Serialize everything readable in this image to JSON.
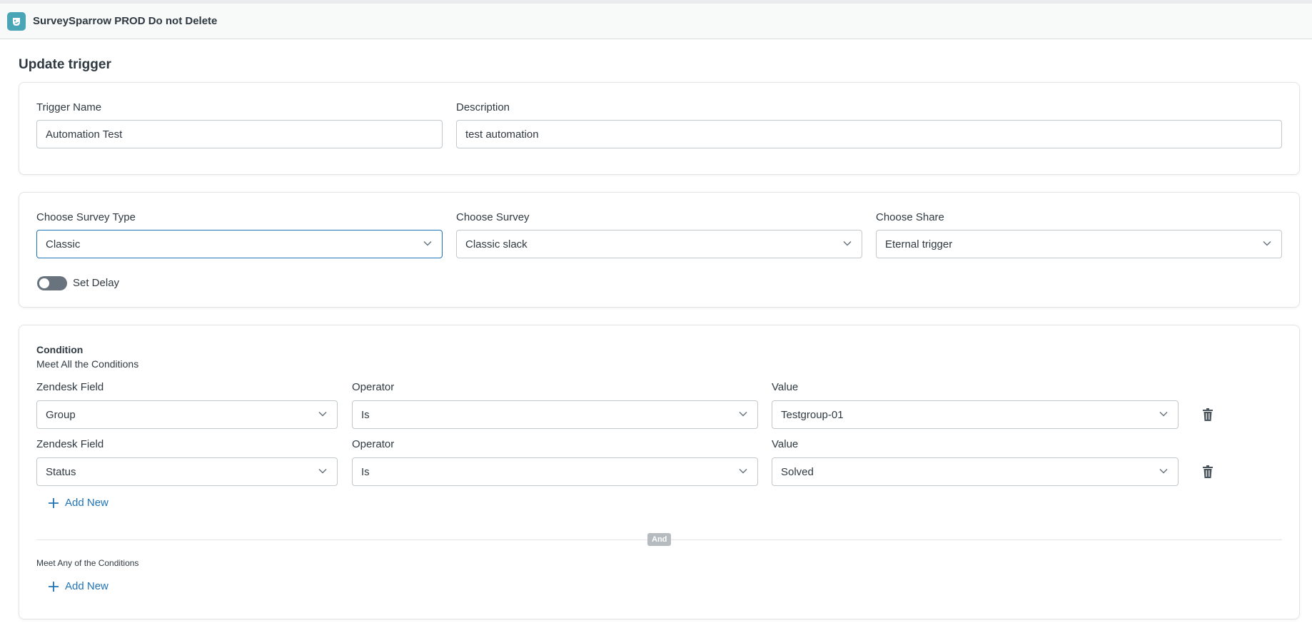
{
  "header": {
    "app_title": "SurveySparrow PROD Do not Delete"
  },
  "page": {
    "title": "Update trigger"
  },
  "trigger_card": {
    "name_label": "Trigger Name",
    "name_value": "Automation Test",
    "description_label": "Description",
    "description_value": "test automation"
  },
  "survey_card": {
    "survey_type_label": "Choose Survey Type",
    "survey_type_value": "Classic",
    "survey_label": "Choose Survey",
    "survey_value": "Classic slack",
    "share_label": "Choose Share",
    "share_value": "Eternal trigger",
    "delay_label": "Set Delay",
    "delay_enabled": false
  },
  "condition_card": {
    "title": "Condition",
    "all_label": "Meet All the Conditions",
    "rows": [
      {
        "field_label": "Zendesk Field",
        "field_value": "Group",
        "operator_label": "Operator",
        "operator_value": "Is",
        "value_label": "Value",
        "value_value": "Testgroup-01"
      },
      {
        "field_label": "Zendesk Field",
        "field_value": "Status",
        "operator_label": "Operator",
        "operator_value": "Is",
        "value_label": "Value",
        "value_value": "Solved"
      }
    ],
    "add_new_label": "Add New",
    "and_label": "And",
    "any_label": "Meet Any of the Conditions",
    "add_new_any_label": "Add New"
  },
  "colors": {
    "accent": "#1f73b7",
    "logo": "#4aa6b6",
    "toggle_off": "#68737d"
  }
}
